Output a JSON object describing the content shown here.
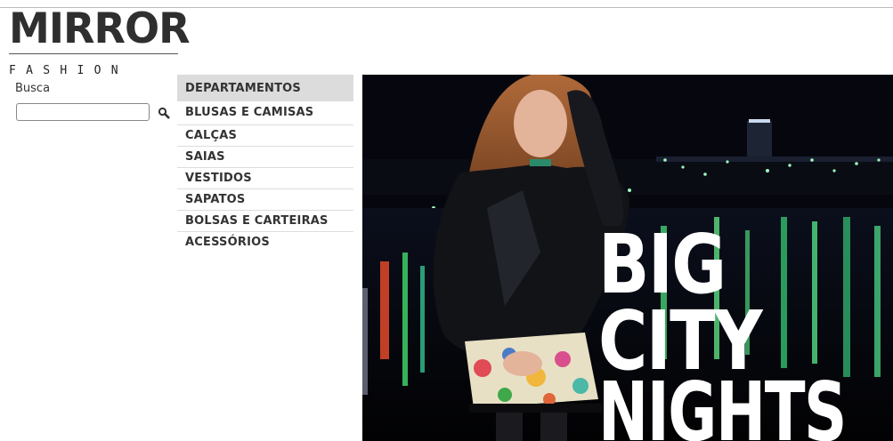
{
  "brand": {
    "name": "MIRROR",
    "tagline": "FASHION"
  },
  "search": {
    "label": "Busca",
    "value": "",
    "placeholder": "",
    "icon": "magnifier-icon"
  },
  "menu": {
    "header": "DEPARTAMENTOS",
    "items": [
      {
        "label": "BLUSAS E CAMISAS"
      },
      {
        "label": "CALÇAS"
      },
      {
        "label": "SAIAS"
      },
      {
        "label": "VESTIDOS"
      },
      {
        "label": "SAPATOS"
      },
      {
        "label": "BOLSAS E CARTEIRAS"
      },
      {
        "label": "ACESSÓRIOS"
      }
    ]
  },
  "banner": {
    "lines": [
      "BIG",
      "CITY",
      "NIGHTS"
    ],
    "colors": {
      "text": "#ffffff",
      "background": "#05060c"
    }
  }
}
